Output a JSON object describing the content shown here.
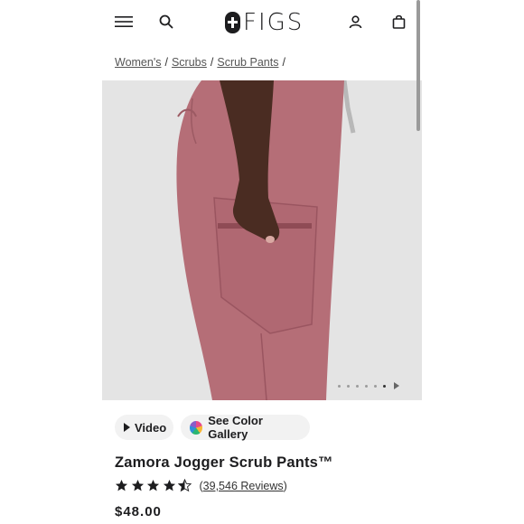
{
  "header": {
    "logo_text": "FIGS",
    "icons": [
      "menu-icon",
      "search-icon",
      "account-icon",
      "bag-icon"
    ]
  },
  "breadcrumb": {
    "items": [
      "Women's",
      "Scrubs",
      "Scrub Pants"
    ],
    "separator": "/"
  },
  "gallery": {
    "dot_count": 6,
    "active_dot": 6
  },
  "actions": {
    "video_label": "Video",
    "color_gallery_label": "See Color Gallery"
  },
  "product": {
    "title": "Zamora Jogger Scrub Pants™",
    "rating": 4.5,
    "reviews_label": "39,546 Reviews",
    "price": "$48.00",
    "color_hex": "#b56e77"
  }
}
